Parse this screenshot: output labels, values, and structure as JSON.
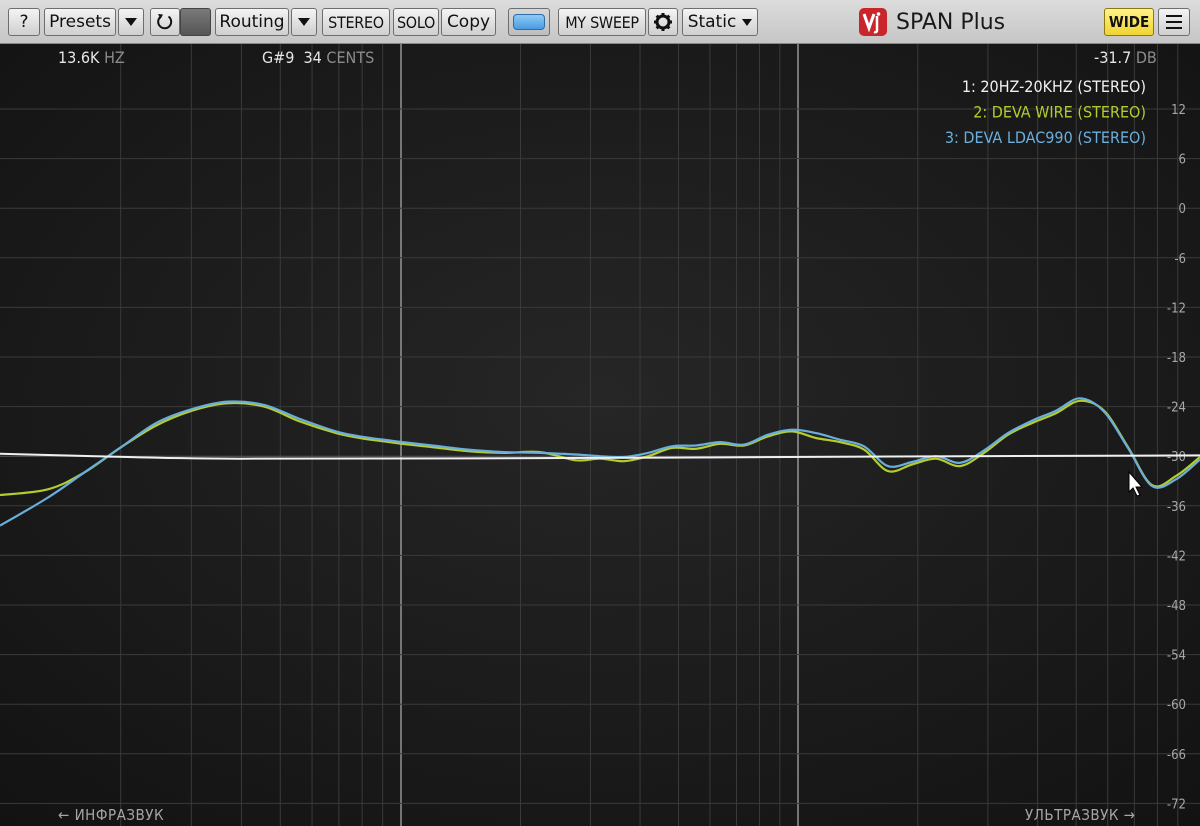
{
  "toolbar": {
    "help_label": "?",
    "presets_label": "Presets",
    "routing_label": "Routing",
    "stereo_label": "STEREO",
    "solo_label": "SOLO",
    "copy_label": "Copy",
    "sweep_label": "MY SWEEP",
    "mode_label": "Static",
    "brand": "SPAN Plus",
    "wide_label": "WIDE"
  },
  "readout": {
    "freq": "13.6K",
    "freq_unit": "HZ",
    "note": "G#9",
    "cents": "34",
    "cents_unit": "CENTS",
    "level": "-31.7",
    "level_unit": "DB"
  },
  "legend": [
    {
      "label": "1: 20HZ-20KHZ (STEREO)",
      "color": "#f0f0f0"
    },
    {
      "label": "2: DEVA WIRE (STEREO)",
      "color": "#b5cc2e"
    },
    {
      "label": "3: DEVA LDAC990 (STEREO)",
      "color": "#6aaedc"
    }
  ],
  "footer": {
    "left": "← ИНФРАЗВУК",
    "right": "УЛЬТРАЗВУК →"
  },
  "chart_data": {
    "type": "line",
    "ylim": [
      -72,
      18
    ],
    "y_ticks": [
      12,
      6,
      0,
      -6,
      -12,
      -18,
      -24,
      -30,
      -36,
      -42,
      -48,
      -54,
      -60,
      -66,
      -72
    ],
    "xlim": [
      0,
      1
    ],
    "grid": true,
    "series": [
      {
        "name": "1: 20HZ-20KHZ (STEREO)",
        "color": "#f0f0f0",
        "x": [
          0,
          0.08,
          0.2,
          0.5,
          0.8,
          1.0
        ],
        "y": [
          -29.7,
          -30.0,
          -30.3,
          -30.2,
          -30.0,
          -29.9
        ]
      },
      {
        "name": "2: DEVA WIRE (STEREO)",
        "color": "#b5cc2e",
        "x": [
          0,
          0.04,
          0.07,
          0.1,
          0.13,
          0.16,
          0.19,
          0.22,
          0.25,
          0.28,
          0.3,
          0.33,
          0.36,
          0.39,
          0.42,
          0.45,
          0.48,
          0.5,
          0.52,
          0.54,
          0.56,
          0.58,
          0.6,
          0.62,
          0.64,
          0.66,
          0.68,
          0.7,
          0.72,
          0.74,
          0.76,
          0.78,
          0.8,
          0.82,
          0.84,
          0.86,
          0.88,
          0.9,
          0.92,
          0.94,
          0.96,
          0.98,
          1.0
        ],
        "y": [
          -34.7,
          -34.0,
          -32.0,
          -29.0,
          -26.3,
          -24.5,
          -23.6,
          -24.0,
          -25.8,
          -27.2,
          -27.8,
          -28.4,
          -28.9,
          -29.4,
          -29.6,
          -29.5,
          -30.5,
          -30.3,
          -30.6,
          -30.0,
          -29.0,
          -29.1,
          -28.5,
          -28.7,
          -27.6,
          -27.0,
          -27.8,
          -28.3,
          -29.2,
          -31.8,
          -31.0,
          -30.3,
          -31.2,
          -29.6,
          -27.4,
          -26.0,
          -24.8,
          -23.3,
          -24.5,
          -28.9,
          -33.5,
          -32.4,
          -30.1
        ]
      },
      {
        "name": "3: DEVA LDAC990 (STEREO)",
        "color": "#6aaedc",
        "x": [
          0,
          0.04,
          0.07,
          0.1,
          0.13,
          0.16,
          0.19,
          0.22,
          0.25,
          0.28,
          0.3,
          0.33,
          0.36,
          0.39,
          0.42,
          0.45,
          0.48,
          0.5,
          0.52,
          0.54,
          0.56,
          0.58,
          0.6,
          0.62,
          0.64,
          0.66,
          0.68,
          0.7,
          0.72,
          0.74,
          0.76,
          0.78,
          0.8,
          0.82,
          0.84,
          0.86,
          0.88,
          0.9,
          0.92,
          0.94,
          0.96,
          0.98,
          1.0
        ],
        "y": [
          -38.4,
          -35.0,
          -32.0,
          -29.0,
          -26.0,
          -24.3,
          -23.4,
          -23.8,
          -25.5,
          -27.0,
          -27.6,
          -28.2,
          -28.7,
          -29.2,
          -29.5,
          -29.6,
          -29.8,
          -30.0,
          -30.1,
          -29.6,
          -28.8,
          -28.7,
          -28.3,
          -28.6,
          -27.4,
          -26.8,
          -27.2,
          -28.0,
          -28.8,
          -31.2,
          -30.7,
          -30.0,
          -30.8,
          -29.3,
          -27.2,
          -25.7,
          -24.5,
          -23.0,
          -24.6,
          -29.0,
          -33.6,
          -32.8,
          -30.4
        ]
      }
    ]
  }
}
